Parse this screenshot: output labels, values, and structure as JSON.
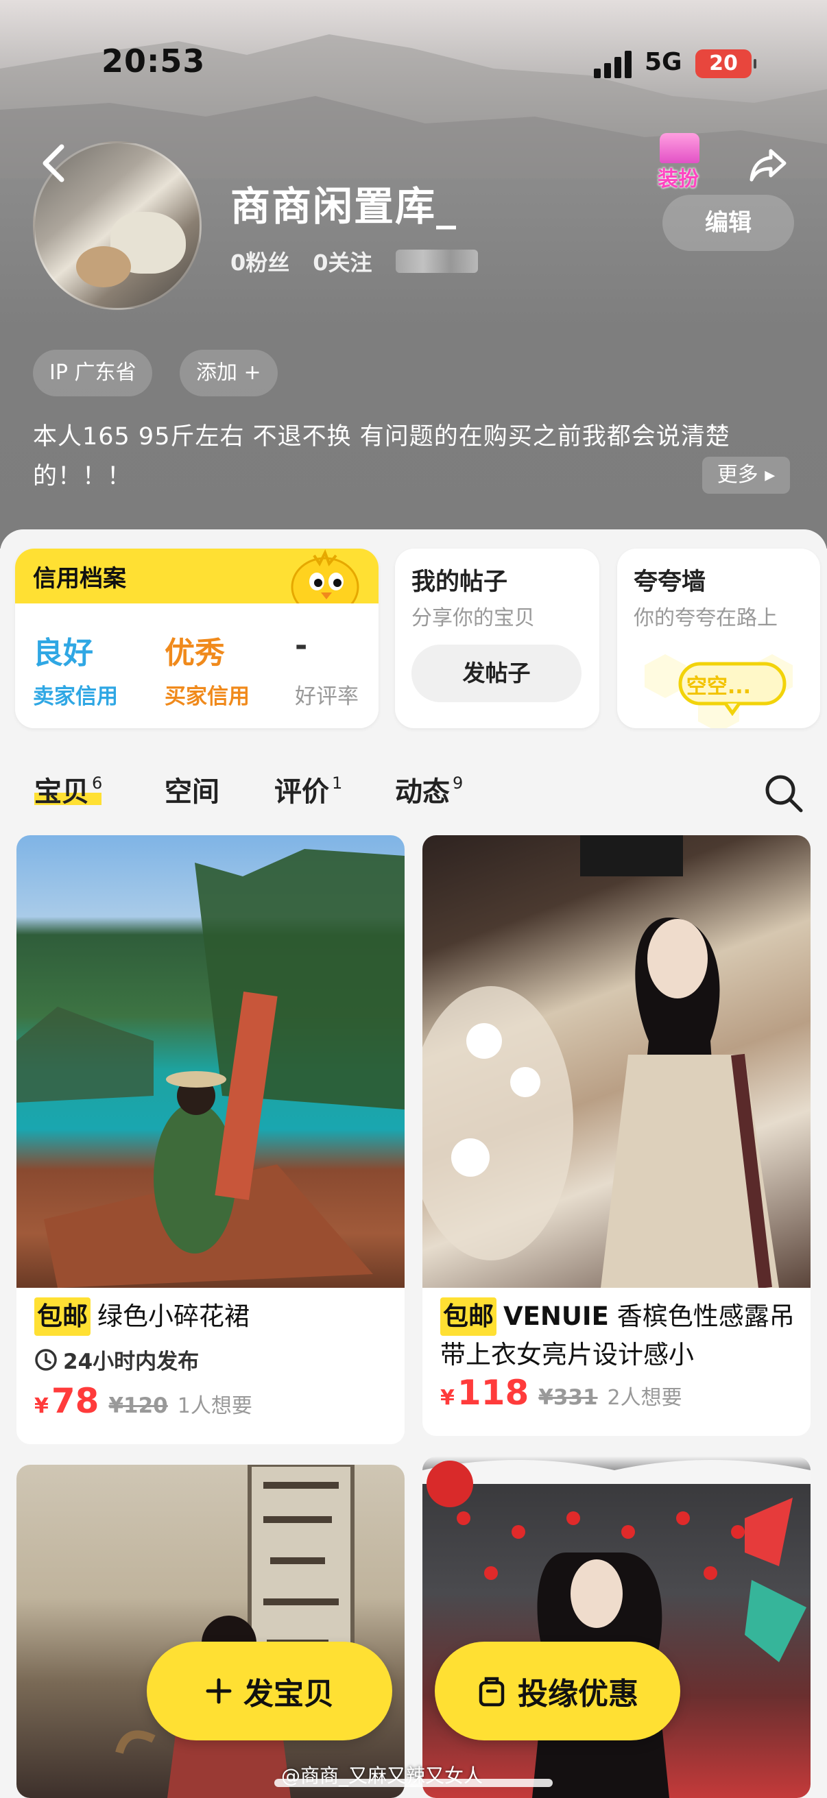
{
  "status_bar": {
    "time": "20:53",
    "network": "5G",
    "battery": "20"
  },
  "profile": {
    "name": "商商闲置库_",
    "fans": "0粉丝",
    "following": "0关注",
    "dressup_label": "装扮",
    "edit_label": "编辑",
    "ip_chip": "IP 广东省",
    "add_chip": "添加 +",
    "bio": "本人165  95斤左右  不退不换  有问题的在购买之前我都会说清楚的！！！",
    "more_label": "更多"
  },
  "credit": {
    "title": "信用档案",
    "seller_value": "良好",
    "seller_label": "卖家信用",
    "buyer_value": "优秀",
    "buyer_label": "买家信用",
    "rate_value": "-",
    "rate_label": "好评率",
    "colors": {
      "seller": "#2fa7e4",
      "buyer": "#f08a1c",
      "accent": "#ffe033"
    }
  },
  "posts_card": {
    "title": "我的帖子",
    "subtitle": "分享你的宝贝",
    "button": "发帖子"
  },
  "praise_card": {
    "title": "夸夸墙",
    "subtitle": "你的夸夸在路上",
    "bubble": "空空..."
  },
  "tabs": [
    {
      "label": "宝贝",
      "count": "6"
    },
    {
      "label": "空间",
      "count": ""
    },
    {
      "label": "评价",
      "count": "1"
    },
    {
      "label": "动态",
      "count": "9"
    }
  ],
  "items": [
    {
      "tag": "包邮",
      "title": "绿色小碎花裙",
      "brand": "",
      "badge": "24小时内发布",
      "currency": "¥",
      "price": "78",
      "original_price": "¥120",
      "wants": "1人想要"
    },
    {
      "tag": "包邮",
      "brand": "VENUIE",
      "title": "香槟色性感露吊带上衣女亮片设计感小",
      "currency": "¥",
      "price": "118",
      "original_price": "¥331",
      "wants": "2人想要"
    }
  ],
  "fab": {
    "publish_label": "发宝贝",
    "deal_label": "投缘优惠"
  },
  "watermark": "@商商_又麻又辣又女人"
}
